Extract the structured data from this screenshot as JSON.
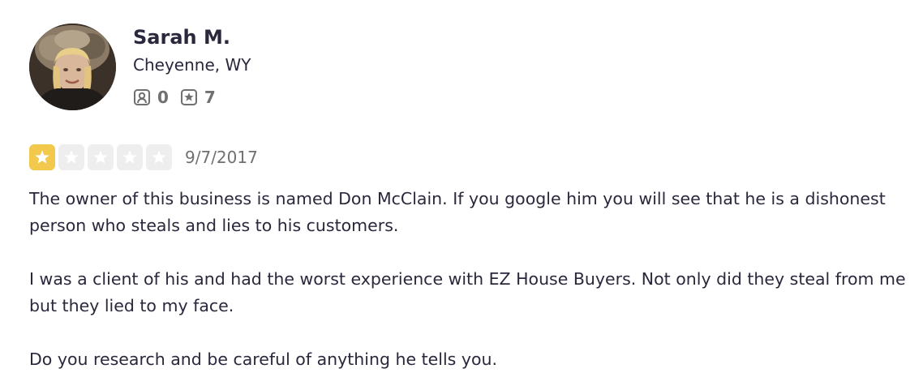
{
  "reviewer": {
    "name": "Sarah M.",
    "location": "Cheyenne, WY",
    "friends_count": "0",
    "reviews_count": "7",
    "friends_icon": "friends-icon",
    "reviews_icon": "review-star-icon"
  },
  "review": {
    "rating": 1,
    "max_rating": 5,
    "date": "9/7/2017",
    "paragraphs": [
      "The owner of this business is named Don McClain. If you google him you will see that he is a dishonest person who steals and lies to his customers.",
      "I was a client of his and had the worst experience with EZ House Buyers. Not only did they steal from me but they lied to my face.",
      "Do you research and be careful of anything he tells you."
    ]
  },
  "colors": {
    "text": "#2b273c",
    "muted": "#6e7072",
    "star_filled": "#f2c94c",
    "star_empty": "#eeeeef"
  }
}
